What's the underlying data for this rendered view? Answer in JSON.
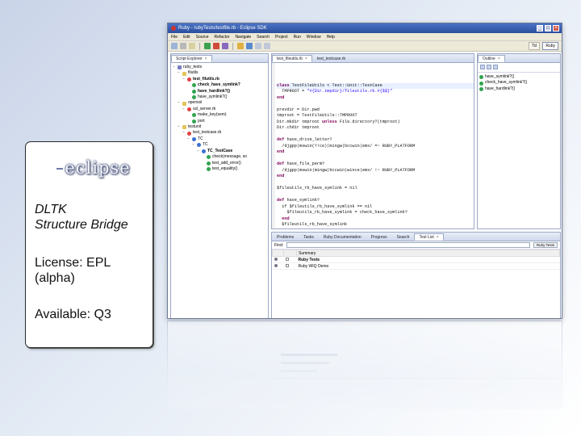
{
  "card": {
    "logo_text": "eclipse",
    "title_line1": "DLTK",
    "title_line2": "Structure Bridge",
    "license_line1": "License: EPL",
    "license_line2": "(alpha)",
    "available": "Available: Q3"
  },
  "window": {
    "title": "Ruby - rubyTests/testfile.rb - Eclipse SDK",
    "menu": [
      "File",
      "Edit",
      "Source",
      "Refactor",
      "Navigate",
      "Search",
      "Project",
      "Run",
      "Window",
      "Help"
    ],
    "perspectives": [
      "Tcl",
      "Ruby"
    ]
  },
  "explorer": {
    "tab": "Script Explorer",
    "tree": [
      {
        "depth": 0,
        "icon": "proj",
        "toggle": "−",
        "label": "ruby_tests",
        "bold": false
      },
      {
        "depth": 1,
        "icon": "folder",
        "toggle": "−",
        "label": "filutils",
        "bold": false
      },
      {
        "depth": 2,
        "icon": "file",
        "toggle": "−",
        "label": "test_filutils.rb",
        "bold": true
      },
      {
        "depth": 3,
        "icon": "meth",
        "toggle": "",
        "label": "check_have_symlink?",
        "bold": true
      },
      {
        "depth": 3,
        "icon": "meth",
        "toggle": "",
        "label": "have_hardlink?()",
        "bold": true
      },
      {
        "depth": 3,
        "icon": "meth",
        "toggle": "",
        "label": "have_symlink?()",
        "bold": false
      },
      {
        "depth": 1,
        "icon": "folder",
        "toggle": "−",
        "label": "openssl",
        "bold": false
      },
      {
        "depth": 2,
        "icon": "file",
        "toggle": "−",
        "label": "ssl_server.rb",
        "bold": false
      },
      {
        "depth": 3,
        "icon": "meth",
        "toggle": "",
        "label": "make_key(sem)",
        "bold": false
      },
      {
        "depth": 3,
        "icon": "meth",
        "toggle": "",
        "label": "port",
        "bold": false
      },
      {
        "depth": 1,
        "icon": "folder",
        "toggle": "−",
        "label": "testunit",
        "bold": false
      },
      {
        "depth": 2,
        "icon": "file",
        "toggle": "−",
        "label": "test_testcase.rb",
        "bold": false
      },
      {
        "depth": 3,
        "icon": "cls",
        "toggle": "−",
        "label": "TC",
        "bold": false
      },
      {
        "depth": 4,
        "icon": "cls",
        "toggle": "−",
        "label": "TC",
        "bold": false
      },
      {
        "depth": 5,
        "icon": "cls",
        "toggle": "−",
        "label": "TC_TestCase",
        "bold": true
      },
      {
        "depth": 6,
        "icon": "meth",
        "toggle": "",
        "label": "check(message, so",
        "bold": false
      },
      {
        "depth": 6,
        "icon": "meth",
        "toggle": "",
        "label": "test_add_error()",
        "bold": false
      },
      {
        "depth": 6,
        "icon": "meth",
        "toggle": "",
        "label": "test_equality()",
        "bold": false
      }
    ]
  },
  "editor": {
    "tabs": [
      "test_fileutils.rb",
      "test_testcase.rb"
    ],
    "lines": [
      [
        {
          "t": "class ",
          "c": "kw"
        },
        {
          "t": "TestFileUtils < Test::Unit::TestCase",
          "c": ""
        }
      ],
      [
        {
          "t": "  TMPROOT = ",
          "c": ""
        },
        {
          "t": "\"#{Dir.tmpdir}/fileutils.rb.#{$$}\"",
          "c": "st"
        }
      ],
      [
        {
          "t": "end",
          "c": "kw"
        }
      ],
      [
        {
          "t": "",
          "c": ""
        }
      ],
      [
        {
          "t": "prevdir = Dir.pwd",
          "c": ""
        }
      ],
      [
        {
          "t": "tmproot = TestFileUtils::TMPROOT",
          "c": ""
        }
      ],
      [
        {
          "t": "Dir.mkdir tmproot ",
          "c": ""
        },
        {
          "t": "unless",
          "c": "kw"
        },
        {
          "t": " File.directory?(tmproot)",
          "c": ""
        }
      ],
      [
        {
          "t": "Dir.chdir tmproot",
          "c": ""
        }
      ],
      [
        {
          "t": "",
          "c": ""
        }
      ],
      [
        {
          "t": "def ",
          "c": "kw"
        },
        {
          "t": "have_drive_letter?",
          "c": ""
        }
      ],
      [
        {
          "t": "  /djgpp|mswin(?!ce)|mingw|bccwin|emx/ =~ RUBY_PLATFORM",
          "c": ""
        }
      ],
      [
        {
          "t": "end",
          "c": "kw"
        }
      ],
      [
        {
          "t": "",
          "c": ""
        }
      ],
      [
        {
          "t": "def ",
          "c": "kw"
        },
        {
          "t": "have_file_perm?",
          "c": ""
        }
      ],
      [
        {
          "t": "  /djgpp|mswin|mingw|bccwin|wince|emx/ !~ RUBY_PLATFORM",
          "c": ""
        }
      ],
      [
        {
          "t": "end",
          "c": "kw"
        }
      ],
      [
        {
          "t": "",
          "c": ""
        }
      ],
      [
        {
          "t": "$fileutils_rb_have_symlink = nil",
          "c": ""
        }
      ],
      [
        {
          "t": "",
          "c": ""
        }
      ],
      [
        {
          "t": "def ",
          "c": "kw"
        },
        {
          "t": "have_symlink?",
          "c": ""
        }
      ],
      [
        {
          "t": "  if $fileutils_rb_have_symlink == nil",
          "c": ""
        }
      ],
      [
        {
          "t": "    $fileutils_rb_have_symlink = check_have_symlink?",
          "c": ""
        }
      ],
      [
        {
          "t": "  end",
          "c": "kw"
        }
      ],
      [
        {
          "t": "  $fileutils_rb_have_symlink",
          "c": ""
        }
      ]
    ]
  },
  "outline": {
    "tab": "Outline",
    "items": [
      "have_symlink?()",
      "check_have_symlink?()",
      "have_hardlink?()"
    ]
  },
  "bottom": {
    "tabs": [
      "Problems",
      "Tasks",
      "Ruby Documentation",
      "Progress",
      "Search",
      "Test List"
    ],
    "find_label": "Find:",
    "run_button": "Ruby Tests",
    "column_summary": "Summary",
    "rows": [
      "Ruby Tests",
      "Ruby WIQ Demo"
    ]
  }
}
